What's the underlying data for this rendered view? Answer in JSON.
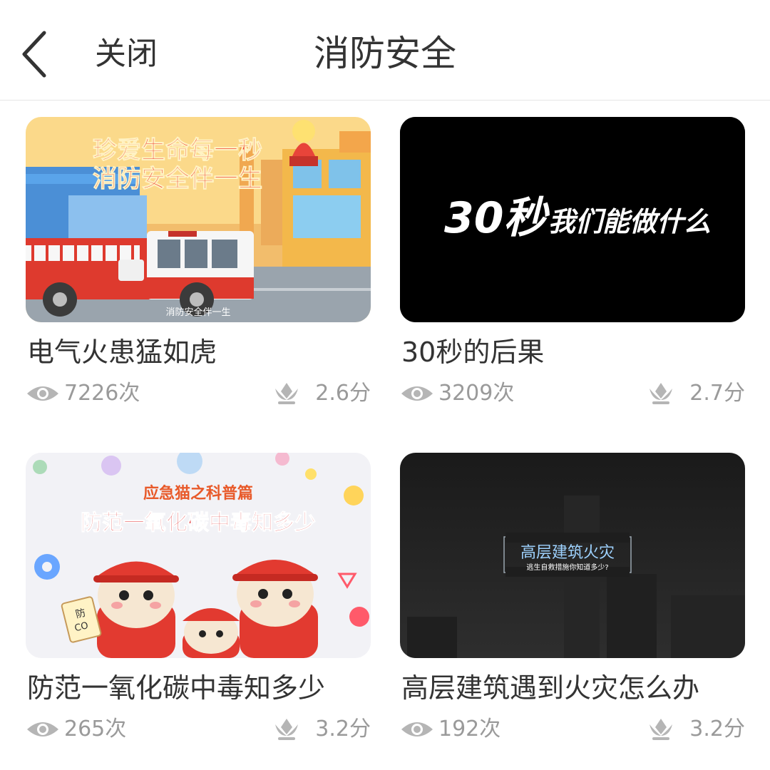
{
  "header": {
    "back_icon": "chevron-left-icon",
    "close_label": "关闭",
    "title": "消防安全"
  },
  "videos": [
    {
      "title": "电气火患猛如虎",
      "views": "7226次",
      "duration": "2.6分",
      "thumb_text_1": "珍爱生命每一秒",
      "thumb_text_2": "消防安全伴一生",
      "thumb_caption": "消防安全伴一生"
    },
    {
      "title": "30秒的后果",
      "views": "3209次",
      "duration": "2.7分",
      "thumb_big": "30秒",
      "thumb_small": "我们能做什么"
    },
    {
      "title": "防范一氧化碳中毒知多少",
      "views": "265次",
      "duration": "3.2分",
      "thumb_text_1": "应急猫之科普篇",
      "thumb_text_2": "防范一氧化碳中毒知多少",
      "thumb_sign_1": "防",
      "thumb_sign_2": "CO"
    },
    {
      "title": "高层建筑遇到火灾怎么办",
      "views": "192次",
      "duration": "3.2分",
      "thumb_text_1": "高层建筑火灾",
      "thumb_text_2": "逃生自救措施你知道多少?"
    }
  ],
  "icons": {
    "views": "eye-icon",
    "duration": "flower-icon"
  },
  "colors": {
    "text": "#333333",
    "meta": "#9a9a9a",
    "divider": "#e6e6e6"
  }
}
